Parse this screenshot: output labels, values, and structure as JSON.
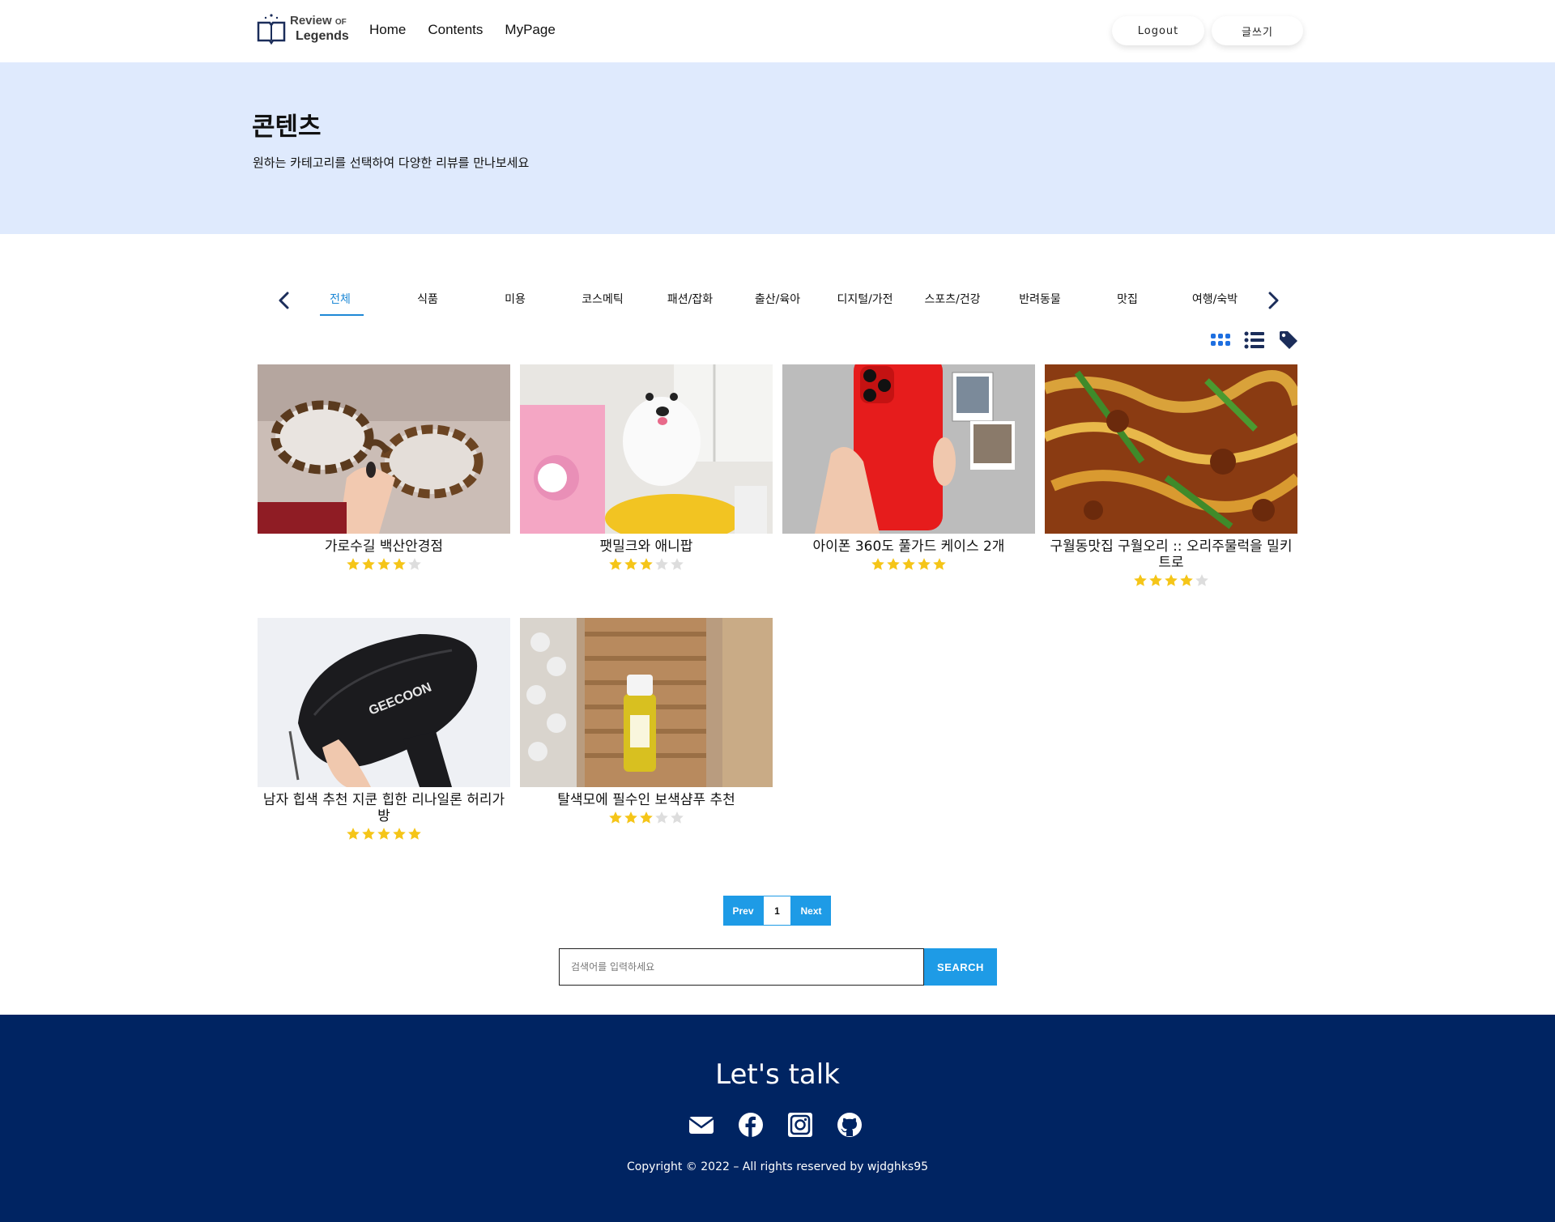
{
  "header": {
    "logo_line1": "Review",
    "logo_of": "OF",
    "logo_line2": "Legends",
    "nav": [
      "Home",
      "Contents",
      "MyPage"
    ],
    "logout_label": "Logout",
    "write_label": "글쓰기"
  },
  "hero": {
    "title": "콘텐츠",
    "subtitle": "원하는 카테고리를 선택하여 다양한 리뷰를 만나보세요"
  },
  "categories": [
    "전체",
    "식품",
    "미용",
    "코스메틱",
    "패션/잡화",
    "출산/육아",
    "디지털/가전",
    "스포츠/건강",
    "반려동물",
    "맛집",
    "여행/숙박"
  ],
  "active_category": "전체",
  "view_icons": [
    "grid-icon",
    "list-icon",
    "tag-icon"
  ],
  "reviews": [
    {
      "title": "가로수길 백산안경점",
      "rating": 4,
      "image": "glasses"
    },
    {
      "title": "팻밀크와 애니팝",
      "rating": 3,
      "image": "dog"
    },
    {
      "title": "아이폰 360도 풀가드 케이스 2개",
      "rating": 5,
      "image": "phone-case"
    },
    {
      "title": "구월동맛집 구월오리 :: 오리주물럭을 밀키트로",
      "rating": 4,
      "image": "duck-dish"
    },
    {
      "title": "남자 힙색 추천 지쿤 힙한 리나일론 허리가방",
      "rating": 5,
      "image": "hip-bag"
    },
    {
      "title": "탈색모에 필수인 보색샴푸 추천",
      "rating": 3,
      "image": "shampoo"
    }
  ],
  "pagination": {
    "prev": "Prev",
    "page": "1",
    "next": "Next"
  },
  "search": {
    "placeholder": "검색어를 입력하세요",
    "button": "SEARCH"
  },
  "footer": {
    "title": "Let's talk",
    "social": [
      "mail-icon",
      "facebook-icon",
      "instagram-icon",
      "github-icon"
    ],
    "copyright": "Copyright © 2022 – All rights reserved by wjdghks95"
  },
  "colors": {
    "accent": "#1e9be6",
    "hero_bg": "#dfeafd",
    "footer_bg": "#002462",
    "star": "#f5c518",
    "star_empty": "#dddddd"
  }
}
